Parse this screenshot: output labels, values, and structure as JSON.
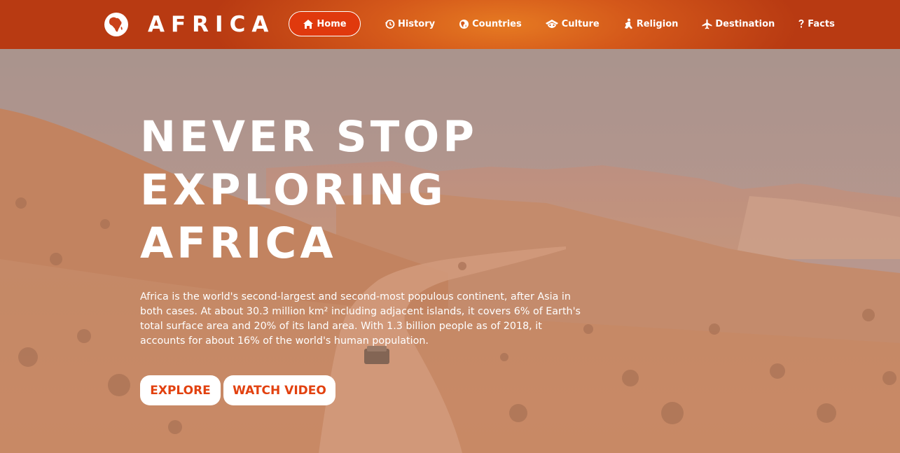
{
  "brand": {
    "name": "AFRICA",
    "icon": "globe-africa-icon"
  },
  "nav": {
    "items": [
      {
        "label": "Home",
        "icon": "home-icon",
        "active": true
      },
      {
        "label": "History",
        "icon": "history-icon"
      },
      {
        "label": "Countries",
        "icon": "globe-icon"
      },
      {
        "label": "Culture",
        "icon": "mask-icon"
      },
      {
        "label": "Religion",
        "icon": "pray-icon"
      },
      {
        "label": "Destination",
        "icon": "plane-icon"
      },
      {
        "label": "Facts",
        "icon": "question-icon"
      }
    ]
  },
  "hero": {
    "title_lines": [
      "NEVER STOP",
      "EXPLORING",
      "AFRICA"
    ],
    "description": "Africa is the world's second-largest and second-most populous continent, after Asia in both cases. At about 30.3 million km² including adjacent islands, it covers 6% of Earth's total surface area and 20% of its land area. With 1.3 billion people as of 2018, it accounts for about 16% of the world's human population.",
    "buttons": {
      "explore": "EXPLORE",
      "watch": "WATCH VIDEO"
    }
  },
  "colors": {
    "nav_start": "#b83a12",
    "nav_center": "#e67a22",
    "active_pill": "#e0390d",
    "button_text": "#e2410f",
    "overlay": "#c9866a"
  }
}
